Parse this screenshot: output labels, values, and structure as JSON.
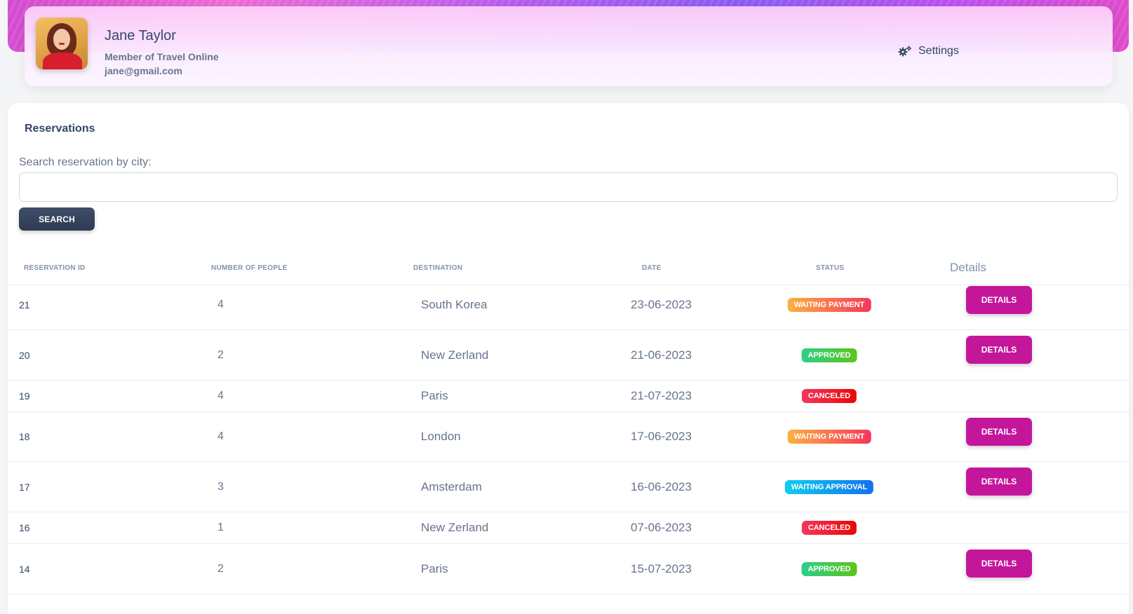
{
  "profile": {
    "name": "Jane Taylor",
    "role": "Member of Travel Online",
    "email": "jane@gmail.com",
    "settings_label": "Settings",
    "settings_icon": "gears-icon"
  },
  "reservations": {
    "title": "Reservations",
    "search_label": "Search reservation by city:",
    "search_value": "",
    "search_button": "SEARCH",
    "columns": {
      "id": "RESERVATION ID",
      "people": "NUMBER OF PEOPLE",
      "destination": "DESTINATION",
      "date": "DATE",
      "status": "STATUS",
      "details": "Details"
    },
    "rows": [
      {
        "id": "21",
        "people": "4",
        "destination": "South Korea",
        "date": "23-06-2023",
        "status": "WAITING PAYMENT",
        "status_type": "waiting-payment",
        "details": "DETAILS"
      },
      {
        "id": "20",
        "people": "2",
        "destination": "New Zerland",
        "date": "21-06-2023",
        "status": "APPROVED",
        "status_type": "approved",
        "details": "DETAILS"
      },
      {
        "id": "19",
        "people": "4",
        "destination": "Paris",
        "date": "21-07-2023",
        "status": "CANCELED",
        "status_type": "canceled",
        "details": ""
      },
      {
        "id": "18",
        "people": "4",
        "destination": "London",
        "date": "17-06-2023",
        "status": "WAITING PAYMENT",
        "status_type": "waiting-payment",
        "details": "DETAILS"
      },
      {
        "id": "17",
        "people": "3",
        "destination": "Amsterdam",
        "date": "16-06-2023",
        "status": "WAITING APPROVAL",
        "status_type": "waiting-approval",
        "details": "DETAILS"
      },
      {
        "id": "16",
        "people": "1",
        "destination": "New Zerland",
        "date": "07-06-2023",
        "status": "CANCELED",
        "status_type": "canceled",
        "details": ""
      },
      {
        "id": "14",
        "people": "2",
        "destination": "Paris",
        "date": "15-07-2023",
        "status": "APPROVED",
        "status_type": "approved",
        "details": "DETAILS"
      }
    ]
  },
  "colors": {
    "accent": "#c4169b",
    "search_button": "#344767",
    "waiting_payment": "#fb8c00",
    "approved": "#4caf50",
    "canceled": "#ea0606",
    "waiting_approval": "#1171ef"
  }
}
